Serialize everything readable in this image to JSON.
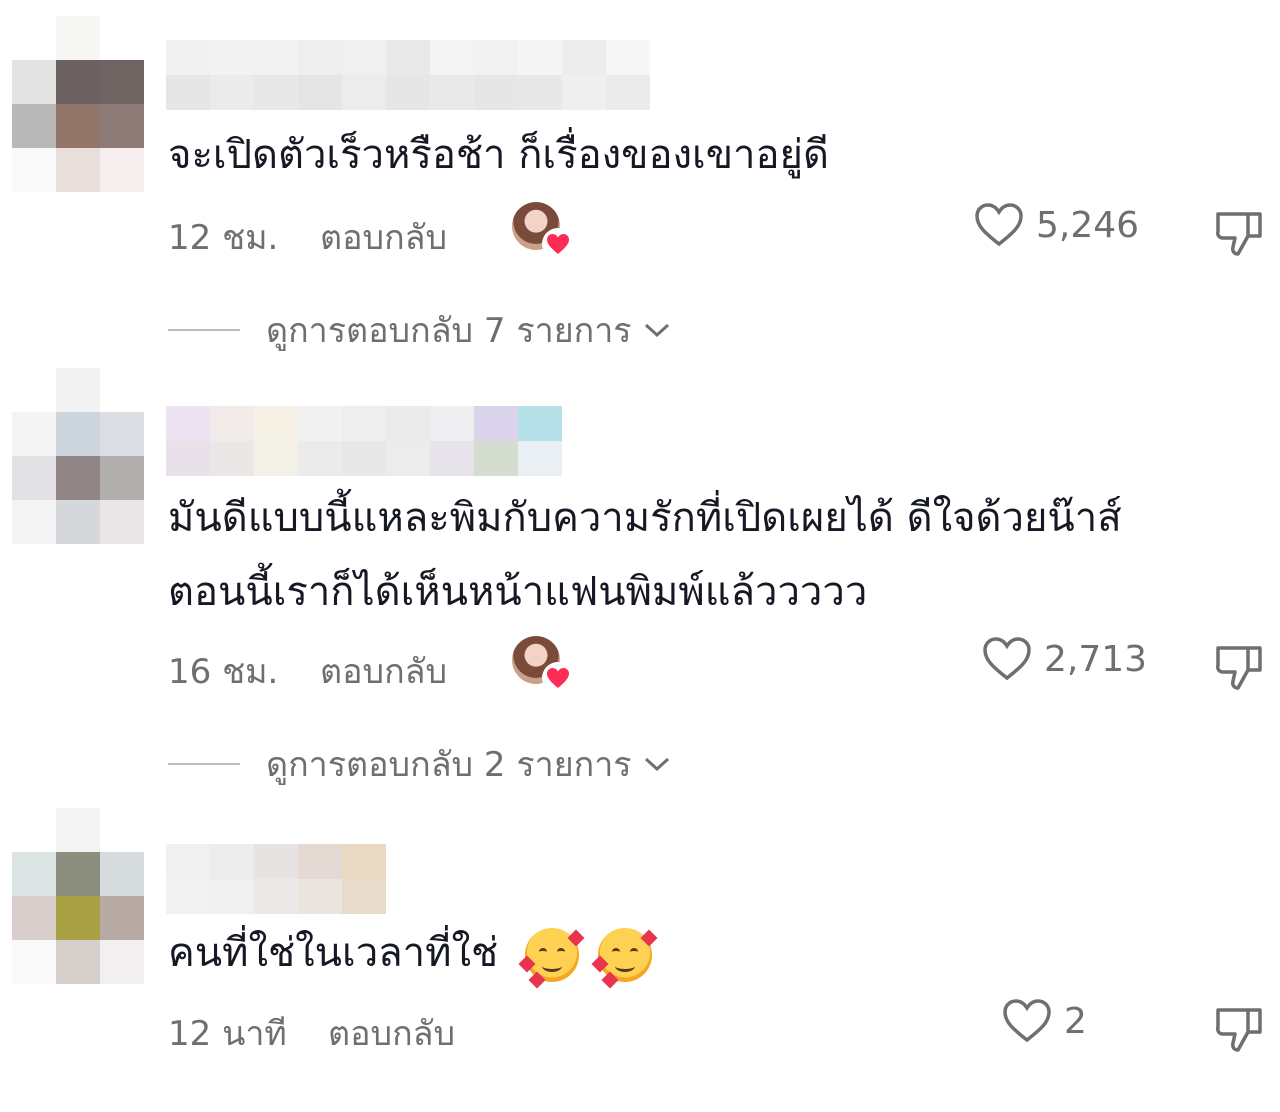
{
  "comments": [
    {
      "text_lines": [
        "จะเปิดตัวเร็วหรือช้า ก็เรื่องของเขาอยู่ดี"
      ],
      "time": "12 ชม.",
      "reply_label": "ตอบกลับ",
      "likes": "5,246",
      "creator_liked": true,
      "view_replies": "ดูการตอบกลับ 7 รายการ",
      "avatar_colors": [
        "#ffffff",
        "#f7f7f5",
        "#ffffff",
        "#e3e3e3",
        "#6c6161",
        "#6e6563",
        "#b8b8b8",
        "#917569",
        "#8c7b76",
        "#fafafa",
        "#e8dfdc",
        "#f6eeee"
      ],
      "name_colors": [
        "#f1f1f1",
        "#e6e6e6",
        "#f3f3f3",
        "#ebebeb",
        "#f2f2f2",
        "#e8e8e8",
        "#eeeeee",
        "#e5e5e5",
        "#f0f0f0",
        "#ececec",
        "#e9e9e9",
        "#e6e6e6",
        "#f4f4f4",
        "#e9e9e9",
        "#f2f2f2",
        "#e6e6e6",
        "#f5f5f5",
        "#e8e8e8",
        "#ededed",
        "#efefef",
        "#f7f7f7",
        "#ebebeb"
      ]
    },
    {
      "text_lines": [
        "มันดีแบบนี้แหละพิมกับความรักที่เปิดเผยได้ ดีใจด้วยน๊าส์",
        "ตอนนี้เราก็ได้เห็นหน้าแฟนพิมพ์แล้ววววว"
      ],
      "time": "16 ชม.",
      "reply_label": "ตอบกลับ",
      "likes": "2,713",
      "creator_liked": true,
      "view_replies": "ดูการตอบกลับ 2 รายการ",
      "avatar_colors": [
        "#ffffff",
        "#f2f2f2",
        "#ffffff",
        "#f4f4f4",
        "#ccd5dc",
        "#dadee2",
        "#e2e2e4",
        "#918586",
        "#b1aeae",
        "#f4f4f4",
        "#d6d7db",
        "#eae5e6"
      ],
      "name_colors": [
        "#ebe3f1",
        "#e9e1ea",
        "#f1ebe9",
        "#ece7e7",
        "#f4f0e3",
        "#f3f1e6",
        "#f1f1f1",
        "#ebebeb",
        "#eeeeee",
        "#e8e8e8",
        "#eaeaea",
        "#ececec",
        "#efeff2",
        "#e6e4ea",
        "#d9d3ec",
        "#d5ddd0",
        "#b7e1e8",
        "#e9eff3"
      ]
    },
    {
      "text_lines": [
        "คนที่ใช่ในเวลาที่ใช่"
      ],
      "time": "12 นาที",
      "reply_label": "ตอบกลับ",
      "likes": "2",
      "creator_liked": false,
      "emoji": [
        "smiling-face-with-hearts-icon",
        "smiling-face-with-hearts-icon"
      ],
      "avatar_colors": [
        "#ffffff",
        "#f4f4f4",
        "#ffffff",
        "#dce3e3",
        "#8c8f7f",
        "#d6dcdd",
        "#d9cecb",
        "#a9a245",
        "#b7aaa2",
        "#fafafa",
        "#d6cfcc",
        "#f1efef"
      ],
      "name_colors": [
        "#f0f0f0",
        "#f2f2f2",
        "#ececec",
        "#f0f0f0",
        "#e8e3e3",
        "#ede8e8",
        "#e4dad3",
        "#ebe4df",
        "#e9d9c3",
        "#e6dbcc"
      ]
    }
  ]
}
